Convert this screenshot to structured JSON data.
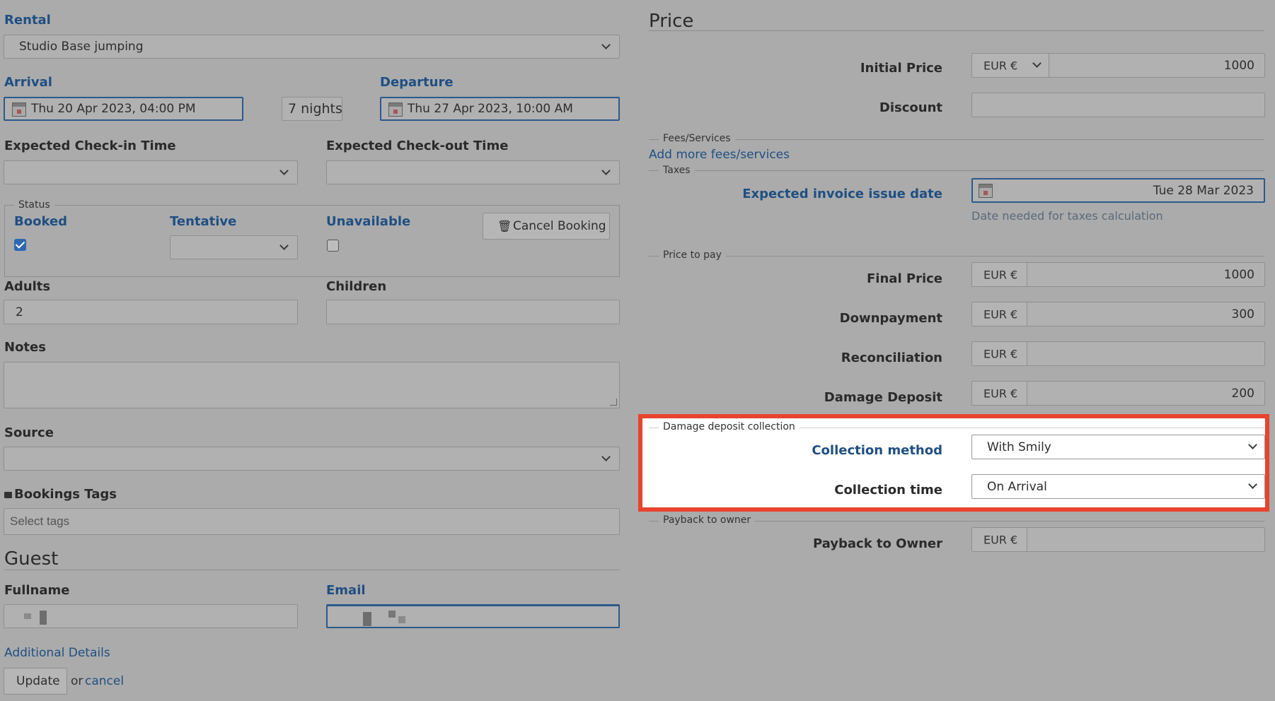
{
  "left": {
    "rental": {
      "label": "Rental",
      "value": "Studio Base jumping"
    },
    "arrival": {
      "label": "Arrival",
      "value": "Thu 20 Apr 2023, 04:00 PM"
    },
    "nights": "7 nights",
    "departure": {
      "label": "Departure",
      "value": "Thu 27 Apr 2023, 10:00 AM"
    },
    "checkin": {
      "label": "Expected Check-in Time",
      "value": ""
    },
    "checkout": {
      "label": "Expected Check-out Time",
      "value": ""
    },
    "status": {
      "legend": "Status",
      "booked": {
        "label": "Booked",
        "checked": true
      },
      "tentative": {
        "label": "Tentative",
        "value": ""
      },
      "unavailable": {
        "label": "Unavailable",
        "checked": false
      },
      "cancel_label": "Cancel Booking"
    },
    "adults": {
      "label": "Adults",
      "value": "2"
    },
    "children": {
      "label": "Children",
      "value": ""
    },
    "notes": {
      "label": "Notes",
      "value": ""
    },
    "source": {
      "label": "Source",
      "value": ""
    },
    "tags": {
      "label": "Bookings Tags",
      "placeholder": "Select tags"
    },
    "guest": {
      "title": "Guest",
      "fullname_label": "Fullname",
      "email_label": "Email"
    },
    "additional_details": "Additional Details",
    "update_label": "Update",
    "or_text": "or",
    "cancel_link": "cancel"
  },
  "right": {
    "title": "Price",
    "initial_price": {
      "label": "Initial Price",
      "currency": "EUR €",
      "value": "1000"
    },
    "discount": {
      "label": "Discount",
      "value": ""
    },
    "fees_legend": "Fees/Services",
    "add_fees": "Add more fees/services",
    "taxes_legend": "Taxes",
    "invoice_date": {
      "label": "Expected invoice issue date",
      "value": "Tue 28 Mar 2023",
      "help": "Date needed for taxes calculation"
    },
    "price_to_pay_legend": "Price to pay",
    "final_price": {
      "label": "Final Price",
      "currency": "EUR €",
      "value": "1000"
    },
    "downpayment": {
      "label": "Downpayment",
      "currency": "EUR €",
      "value": "300"
    },
    "reconciliation": {
      "label": "Reconciliation",
      "currency": "EUR €",
      "value": ""
    },
    "damage_deposit": {
      "label": "Damage Deposit",
      "currency": "EUR €",
      "value": "200"
    },
    "deposit_collection": {
      "legend": "Damage deposit collection",
      "method_label": "Collection method",
      "method_value": "With Smily",
      "time_label": "Collection time",
      "time_value": "On Arrival"
    },
    "payback_legend": "Payback to owner",
    "payback": {
      "label": "Payback to Owner",
      "currency": "EUR €",
      "value": ""
    }
  },
  "colors": {
    "accent": "#1f4f83",
    "highlight": "#e8432e",
    "overlay": "#ababab"
  }
}
